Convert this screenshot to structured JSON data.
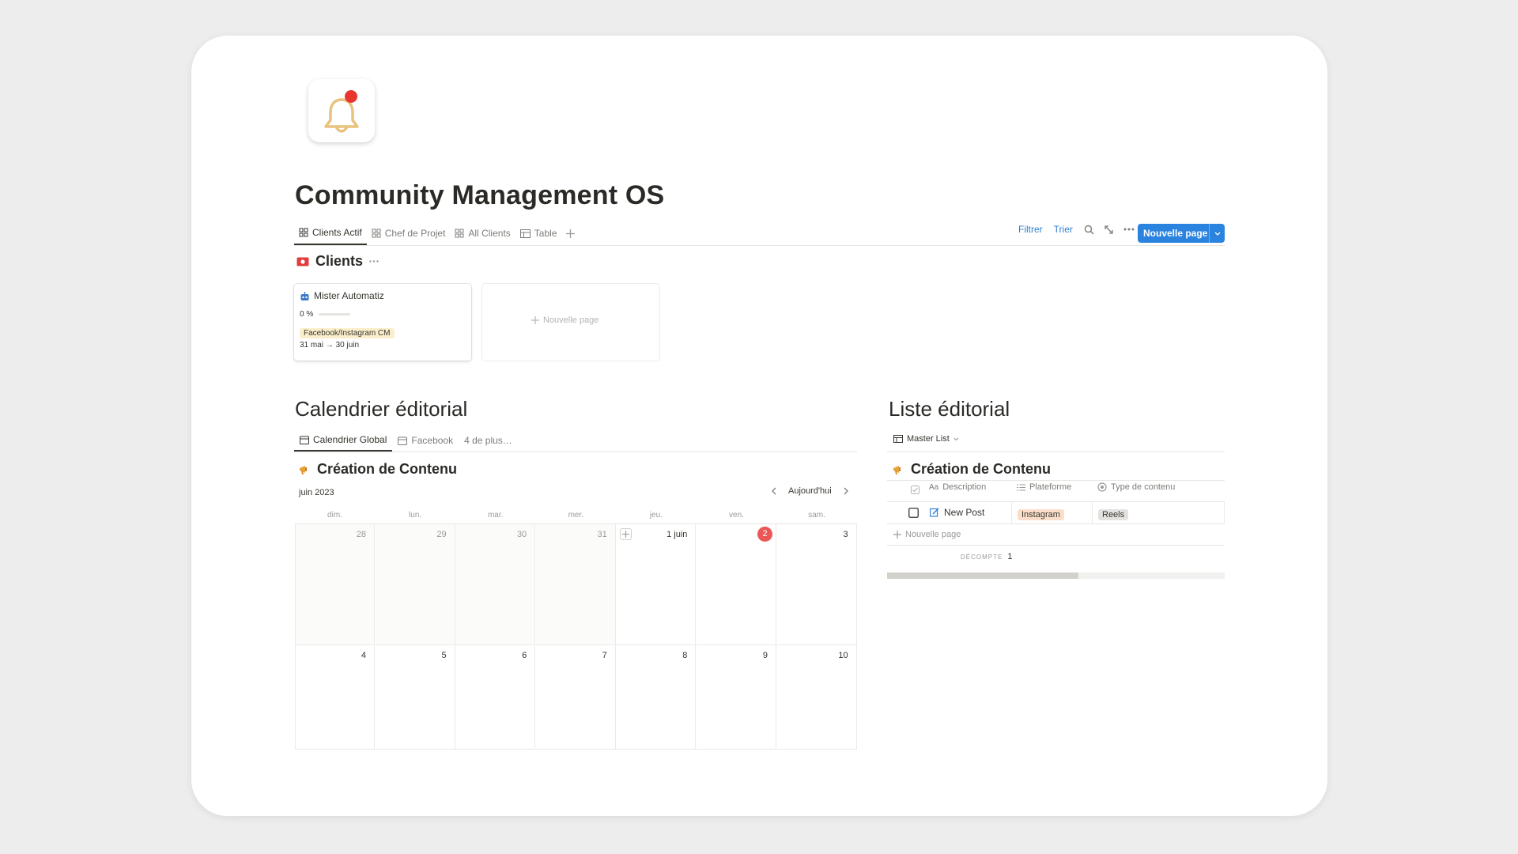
{
  "page": {
    "title": "Community Management OS",
    "icon": "bell-notification-icon"
  },
  "tabs": [
    {
      "label": "Clients Actif",
      "icon": "gallery-icon",
      "active": true
    },
    {
      "label": "Chef de Projet",
      "icon": "gallery-icon"
    },
    {
      "label": "All Clients",
      "icon": "gallery-icon"
    },
    {
      "label": "Table",
      "icon": "table-icon"
    }
  ],
  "toolbar": {
    "filter": "Filtrer",
    "sort": "Trier",
    "new_page": "Nouvelle page"
  },
  "clients": {
    "title": "Clients",
    "card": {
      "name": "Mister Automatiz",
      "progress_label": "0 %",
      "progress": 0,
      "tag": "Facebook/Instagram CM",
      "dates": "31 mai → 30 juin"
    },
    "new_page": "Nouvelle page"
  },
  "calendar": {
    "heading": "Calendrier éditorial",
    "tabs": [
      {
        "label": "Calendrier Global",
        "active": true
      },
      {
        "label": "Facebook"
      },
      {
        "label": "4 de plus…"
      }
    ],
    "db_title": "Création de Contenu",
    "month": "juin 2023",
    "today_label": "Aujourd'hui",
    "weekdays": [
      "dim.",
      "lun.",
      "mar.",
      "mer.",
      "jeu.",
      "ven.",
      "sam."
    ],
    "week1": [
      "28",
      "29",
      "30",
      "31",
      "1 juin",
      "2",
      "3"
    ],
    "week2": [
      "4",
      "5",
      "6",
      "7",
      "8",
      "9",
      "10"
    ],
    "today": "2"
  },
  "list": {
    "heading": "Liste éditorial",
    "view": "Master List",
    "db_title": "Création de Contenu",
    "columns": [
      {
        "label": "Description",
        "icon": "title-icon"
      },
      {
        "label": "Plateforme",
        "icon": "list-icon"
      },
      {
        "label": "Type de contenu",
        "icon": "status-icon"
      }
    ],
    "rows": [
      {
        "title": "New Post",
        "platform": "Instagram",
        "type": "Reels"
      }
    ],
    "new_page": "Nouvelle page",
    "count_label": "DÉCOMPTE",
    "count": "1",
    "colors": {
      "instagram_tag": "#fadec9",
      "reels_tag": "#e3e2e0",
      "facebook_tag": "#fbeecb"
    }
  }
}
